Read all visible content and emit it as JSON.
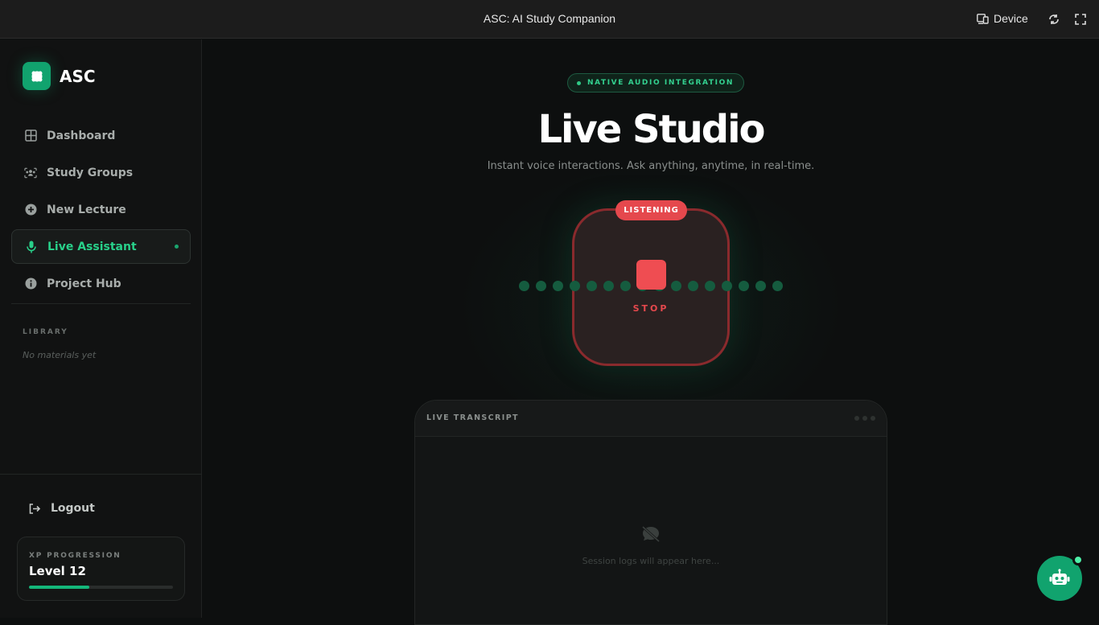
{
  "window": {
    "title": "ASC: AI Study Companion",
    "device_label": "Device"
  },
  "sidebar": {
    "brand": "ASC",
    "items": [
      {
        "label": "Dashboard",
        "icon": "grid-icon"
      },
      {
        "label": "Study Groups",
        "icon": "users-icon"
      },
      {
        "label": "New Lecture",
        "icon": "plus-circle-icon"
      },
      {
        "label": "Live Assistant",
        "icon": "microphone-icon",
        "active": true
      },
      {
        "label": "Project Hub",
        "icon": "info-circle-icon"
      }
    ],
    "library_heading": "LIBRARY",
    "library_empty": "No materials yet",
    "logout_label": "Logout",
    "xp": {
      "label": "XP PROGRESSION",
      "level": "Level 12",
      "progress": 0.42
    }
  },
  "main": {
    "badge": "NATIVE AUDIO INTEGRATION",
    "title": "Live Studio",
    "subtitle": "Instant voice interactions. Ask anything, anytime, in real-time.",
    "status_pill": "LISTENING",
    "stop_label": "STOP",
    "transcript": {
      "title": "LIVE TRANSCRIPT",
      "empty": "Session logs will appear here..."
    }
  },
  "colors": {
    "accent": "#11a36e",
    "accent_text": "#28d08a",
    "danger": "#e5484d",
    "background": "#0d0f0f"
  }
}
